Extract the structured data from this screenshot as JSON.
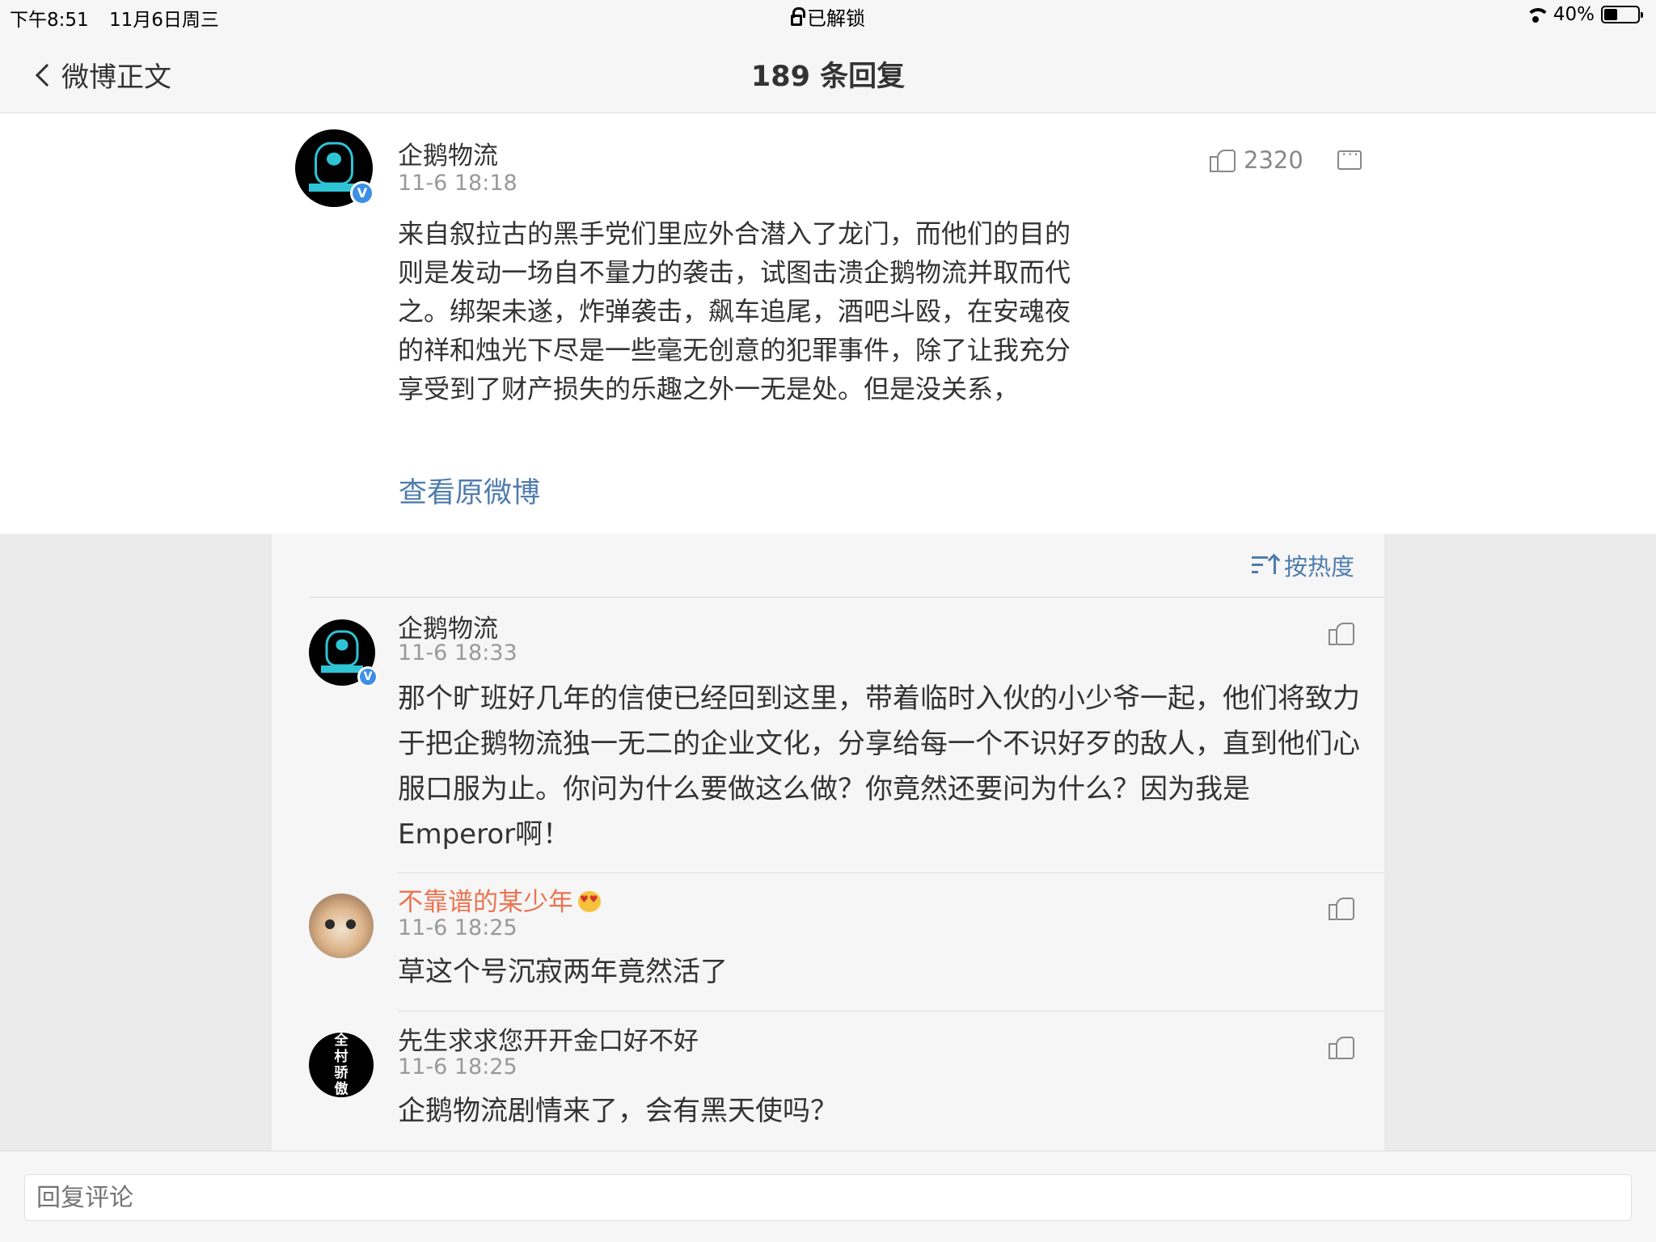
{
  "status_bar": {
    "time": "下午8:51",
    "date": "11月6日周三",
    "lock_status": "已解锁",
    "battery": "40%",
    "battery_level": 0.4
  },
  "nav": {
    "back_label": "微博正文",
    "title": "189 条回复"
  },
  "main_comment": {
    "author": "企鹅物流",
    "time": "11-6 18:18",
    "likes": "2320",
    "text": "来自叙拉古的黑手党们里应外合潜入了龙门，而他们的目的则是发动一场自不量力的袭击，试图击溃企鹅物流并取而代之。绑架未遂，炸弹袭击，飙车追尾，酒吧斗殴，在安魂夜的祥和烛光下尽是一些毫无创意的犯罪事件，除了让我充分享受到了财产损失的乐趣之外一无是处。但是没关系，",
    "view_original": "查看原微博",
    "verified_mark": "V"
  },
  "sort": {
    "label": "按热度"
  },
  "replies": [
    {
      "author": "企鹅物流",
      "time": "11-6 18:33",
      "text": "那个旷班好几年的信使已经回到这里，带着临时入伙的小少爷一起，他们将致力于把企鹅物流独一无二的企业文化，分享给每一个不识好歹的敌人，直到他们心服口服为止。你问为什么要做这么做？你竟然还要问为什么？因为我是Emperor啊！",
      "verified_mark": "V"
    },
    {
      "author": "不靠谱的某少年",
      "time": "11-6 18:25",
      "text": "草这个号沉寂两年竟然活了"
    },
    {
      "author": "先生求求您开开金口好不好",
      "time": "11-6 18:25",
      "text": "企鹅物流剧情来了，会有黑天使吗？",
      "avatar_text": [
        "全",
        "村",
        "骄",
        "傲"
      ]
    }
  ],
  "input": {
    "placeholder": "回复评论"
  },
  "colors": {
    "link": "#4f7cae",
    "username_highlight": "#eb7350",
    "verified": "#3d8fe6"
  }
}
